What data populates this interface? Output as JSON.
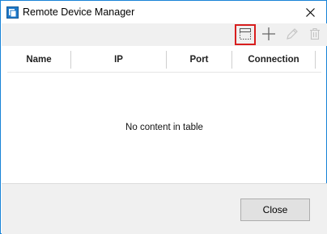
{
  "window": {
    "title": "Remote Device Manager",
    "close_label": "✕"
  },
  "toolbar": {
    "buttons": [
      {
        "icon": "device-frame-icon",
        "state": "highlighted"
      },
      {
        "icon": "plus-icon",
        "state": "enabled"
      },
      {
        "icon": "pencil-icon",
        "state": "disabled"
      },
      {
        "icon": "trash-icon",
        "state": "disabled"
      }
    ]
  },
  "table": {
    "columns": [
      "Name",
      "IP",
      "Port",
      "Connection"
    ],
    "empty_text": "No content in table"
  },
  "footer": {
    "close_label": "Close"
  },
  "colors": {
    "accent_border": "#1883d7",
    "highlight": "#d81e1e"
  }
}
